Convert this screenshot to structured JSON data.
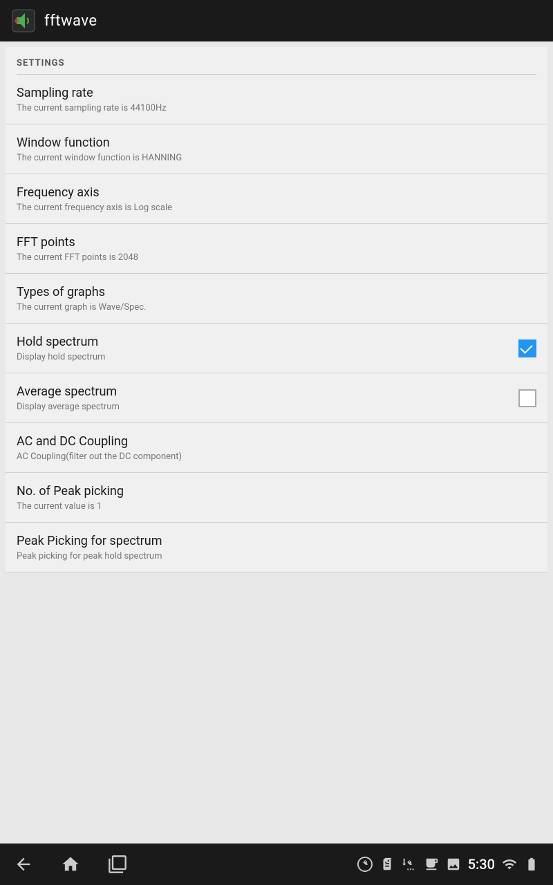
{
  "appBar": {
    "title": "fftwave"
  },
  "settings": {
    "header": "SETTINGS",
    "items": [
      {
        "id": "sampling-rate",
        "title": "Sampling rate",
        "subtitle": "The current sampling rate is 44100Hz",
        "hasCheckbox": false
      },
      {
        "id": "window-function",
        "title": "Window function",
        "subtitle": "The current window function is HANNING",
        "hasCheckbox": false
      },
      {
        "id": "frequency-axis",
        "title": "Frequency axis",
        "subtitle": "The current frequency axis is Log scale",
        "hasCheckbox": false
      },
      {
        "id": "fft-points",
        "title": "FFT points",
        "subtitle": "The current FFT points is 2048",
        "hasCheckbox": false
      },
      {
        "id": "types-of-graphs",
        "title": "Types of graphs",
        "subtitle": "The current graph is Wave/Spec.",
        "hasCheckbox": false
      },
      {
        "id": "hold-spectrum",
        "title": "Hold spectrum",
        "subtitle": "Display hold spectrum",
        "hasCheckbox": true,
        "checked": true
      },
      {
        "id": "average-spectrum",
        "title": "Average spectrum",
        "subtitle": "Display average spectrum",
        "hasCheckbox": true,
        "checked": false
      },
      {
        "id": "ac-dc-coupling",
        "title": "AC and DC Coupling",
        "subtitle": "AC Coupling(filter out the DC component)",
        "hasCheckbox": false
      },
      {
        "id": "no-peak-picking",
        "title": "No. of Peak picking",
        "subtitle": "The current value is 1",
        "hasCheckbox": false
      },
      {
        "id": "peak-picking-spectrum",
        "title": "Peak Picking for spectrum",
        "subtitle": "Peak picking for peak hold spectrum",
        "hasCheckbox": false
      }
    ]
  },
  "navBar": {
    "time": "5:30"
  }
}
